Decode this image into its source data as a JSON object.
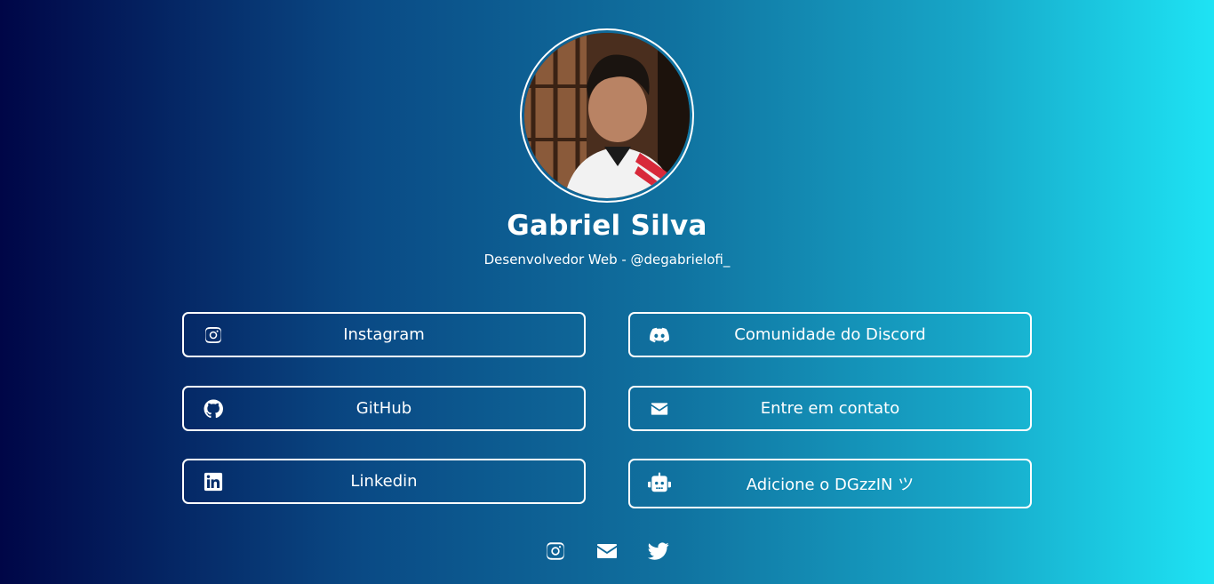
{
  "profile": {
    "name": "Gabriel Silva",
    "subtitle": "Desenvolvedor Web - @degabrielofi_"
  },
  "links": {
    "instagram": {
      "label": "Instagram",
      "icon": "instagram-icon"
    },
    "discord": {
      "label": "Comunidade do Discord",
      "icon": "discord-icon"
    },
    "github": {
      "label": "GitHub",
      "icon": "github-icon"
    },
    "contact": {
      "label": "Entre em contato",
      "icon": "envelope-icon"
    },
    "linkedin": {
      "label": "Linkedin",
      "icon": "linkedin-icon"
    },
    "bot": {
      "label": "Adicione o DGzzIN ツ",
      "icon": "robot-icon"
    }
  },
  "footer": {
    "icons": [
      "instagram-icon",
      "envelope-icon",
      "twitter-icon"
    ]
  },
  "colors": {
    "gradient_start": "#000647",
    "gradient_end": "#1ee3f4",
    "text": "#ffffff"
  }
}
